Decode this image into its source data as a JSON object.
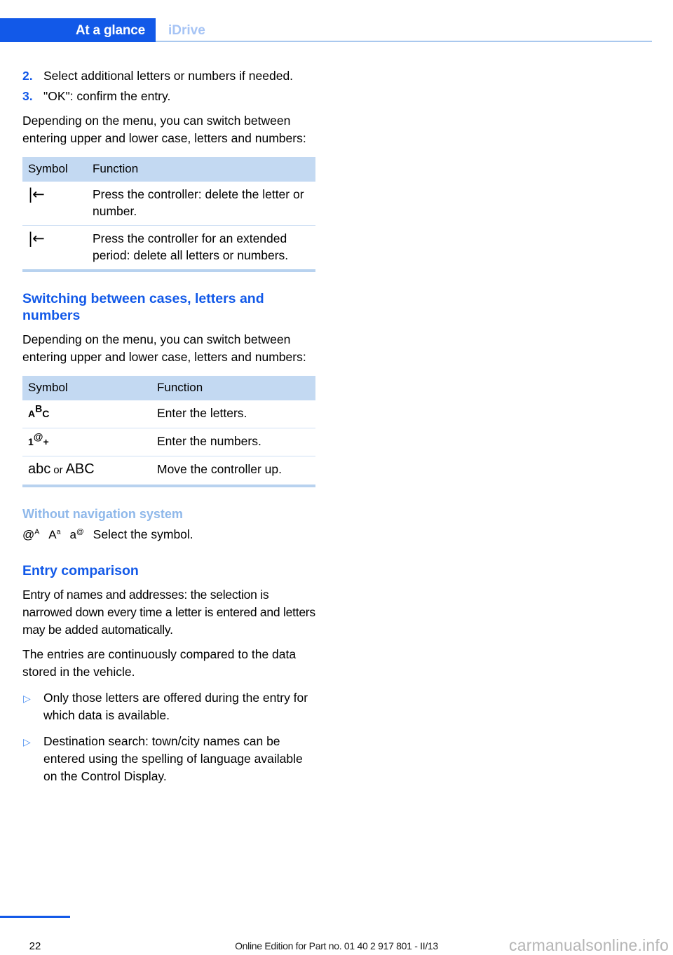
{
  "header": {
    "tab_label": "At a glance",
    "section_label": "iDrive",
    "accent_color": "#1259e8",
    "muted_accent_color": "#a6c4f5"
  },
  "content": {
    "steps": [
      {
        "number": "2.",
        "text": "Select additional letters or numbers if needed."
      },
      {
        "number": "3.",
        "text": "\"OK\": confirm the entry."
      }
    ],
    "intro_paragraph": "Depending on the menu, you can switch between entering upper and lower case, letters and numbers:",
    "table_one": {
      "headers": [
        "Symbol",
        "Function"
      ],
      "rows": [
        {
          "symbol": "|←",
          "function": "Press the controller: delete the letter or number."
        },
        {
          "symbol": "|←",
          "function": "Press the controller for an extended period: delete all letters or numbers."
        }
      ]
    },
    "heading_switching": "Switching between cases, letters and numbers",
    "switching_paragraph": "Depending on the menu, you can switch between entering upper and lower case, letters and numbers:",
    "table_two": {
      "headers": [
        "Symbol",
        "Function"
      ],
      "rows": [
        {
          "symbol_base": "A",
          "symbol_sup": "B",
          "symbol_tail": "C",
          "symbol_plain": "AᴮC",
          "function": "Enter the letters."
        },
        {
          "symbol_base": "1",
          "symbol_sup": "@",
          "symbol_tail": "+",
          "symbol_plain": "1@+",
          "function": "Enter the numbers."
        },
        {
          "symbol_base": "abc",
          "symbol_sup": "",
          "symbol_tail": "ABC",
          "symbol_plain": "abc or ABC",
          "symbol_joiner": "or",
          "function": "Move the controller up."
        }
      ]
    },
    "heading_without_nav": "Without navigation system",
    "without_nav_symbols": [
      {
        "base": "@",
        "sup": "A"
      },
      {
        "base": "A",
        "sup": "a"
      },
      {
        "base": "a",
        "sup": "@"
      }
    ],
    "without_nav_text": "Select the symbol.",
    "heading_entry_comparison": "Entry comparison",
    "entry_paragraphs": [
      "Entry of names and addresses: the selection is narrowed down every time a letter is entered and letters may be added automatically.",
      "The entries are continuously compared to the data stored in the vehicle."
    ],
    "bullets": [
      "Only those letters are offered during the entry for which data is available.",
      "Destination search: town/city names can be entered using the spelling of language available on the Control Display."
    ]
  },
  "footer": {
    "page_number": "22",
    "edition_text": "Online Edition for Part no. 01 40 2 917 801 - II/13",
    "watermark": "carmanualsonline.info"
  }
}
